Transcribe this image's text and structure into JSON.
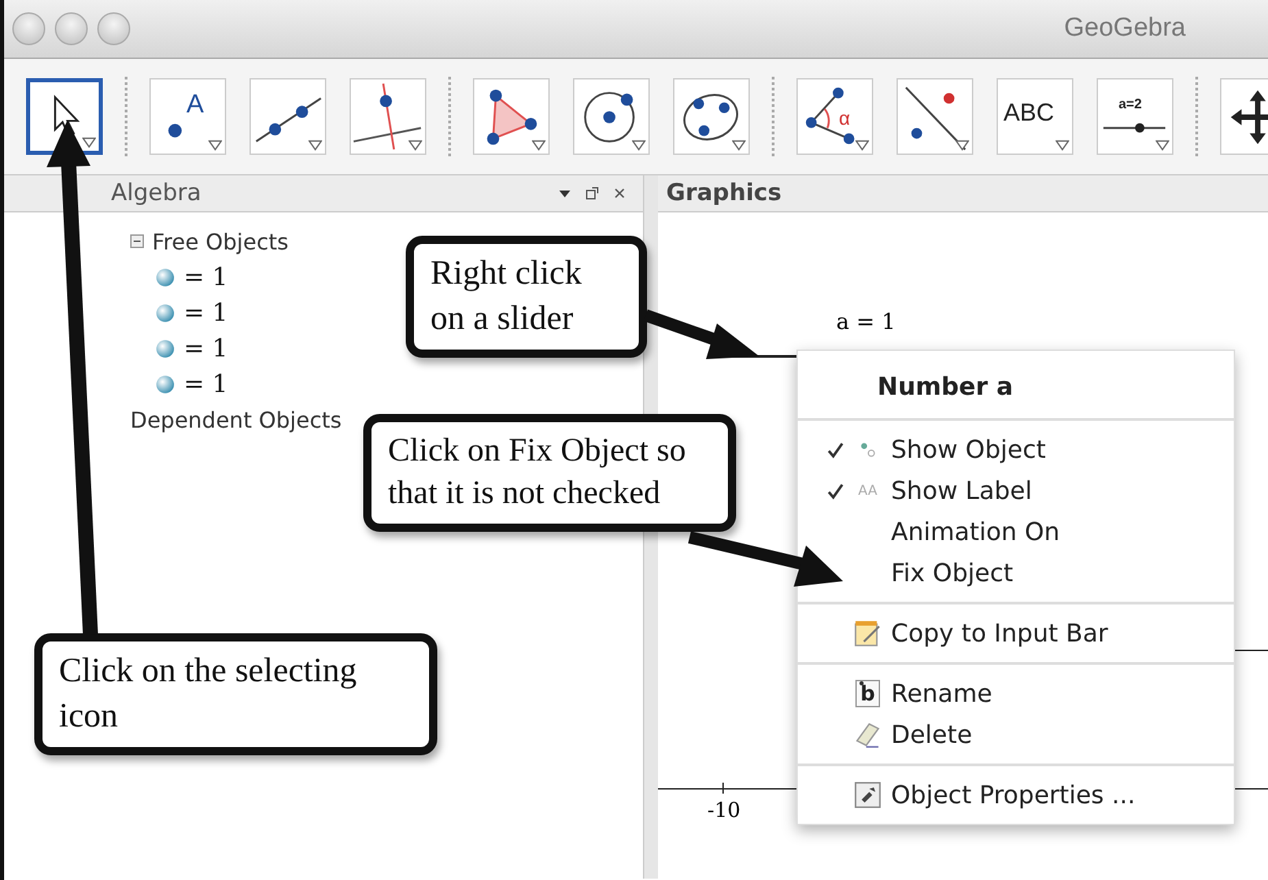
{
  "window": {
    "title": "GeoGebra"
  },
  "toolbar": {
    "groups": [
      [
        {
          "kind": "select",
          "selected": true
        }
      ],
      [
        {
          "kind": "point",
          "selected": false,
          "label": "A"
        },
        {
          "kind": "line",
          "selected": false
        },
        {
          "kind": "perpendicular",
          "selected": false
        }
      ],
      [
        {
          "kind": "polygon",
          "selected": false
        },
        {
          "kind": "circle",
          "selected": false
        },
        {
          "kind": "conic",
          "selected": false
        }
      ],
      [
        {
          "kind": "angle",
          "selected": false,
          "label": "α"
        },
        {
          "kind": "reflect",
          "selected": false
        },
        {
          "kind": "text",
          "selected": false,
          "label": "ABC"
        },
        {
          "kind": "slider",
          "selected": false,
          "label": "a=2"
        }
      ],
      [
        {
          "kind": "move",
          "selected": false
        }
      ]
    ]
  },
  "algebra": {
    "title": "Algebra",
    "tree": [
      {
        "label": "Free Objects",
        "expanded": true,
        "children": [
          {
            "label": "= 1"
          },
          {
            "label": "= 1"
          },
          {
            "label": "= 1"
          },
          {
            "label": "= 1"
          }
        ]
      },
      {
        "label": "Dependent Objects"
      }
    ]
  },
  "graphics": {
    "title": "Graphics",
    "slider_label": "a = 1",
    "axis_label": "-10"
  },
  "context_menu": {
    "title": "Number a",
    "sections": [
      [
        {
          "label": "Show Object",
          "kind": "check-points",
          "checked": true
        },
        {
          "label": "Show Label",
          "kind": "check-label",
          "checked": true,
          "icon_text": "AA"
        },
        {
          "label": "Animation On",
          "kind": "check",
          "checked": false
        },
        {
          "label": "Fix Object",
          "kind": "check",
          "checked": false
        }
      ],
      [
        {
          "label": "Copy to Input Bar",
          "kind": "copy"
        }
      ],
      [
        {
          "label": "Rename",
          "kind": "rename",
          "icon_text": "b"
        },
        {
          "label": "Delete",
          "kind": "delete"
        }
      ],
      [
        {
          "label": "Object Properties ...",
          "kind": "properties"
        }
      ]
    ]
  },
  "callouts": [
    {
      "kind": "slider",
      "text": "Right click on a slider"
    },
    {
      "kind": "fix",
      "text": "Click on Fix Object so that it is not checked"
    },
    {
      "kind": "select",
      "text": "Click on the selecting icon"
    }
  ]
}
